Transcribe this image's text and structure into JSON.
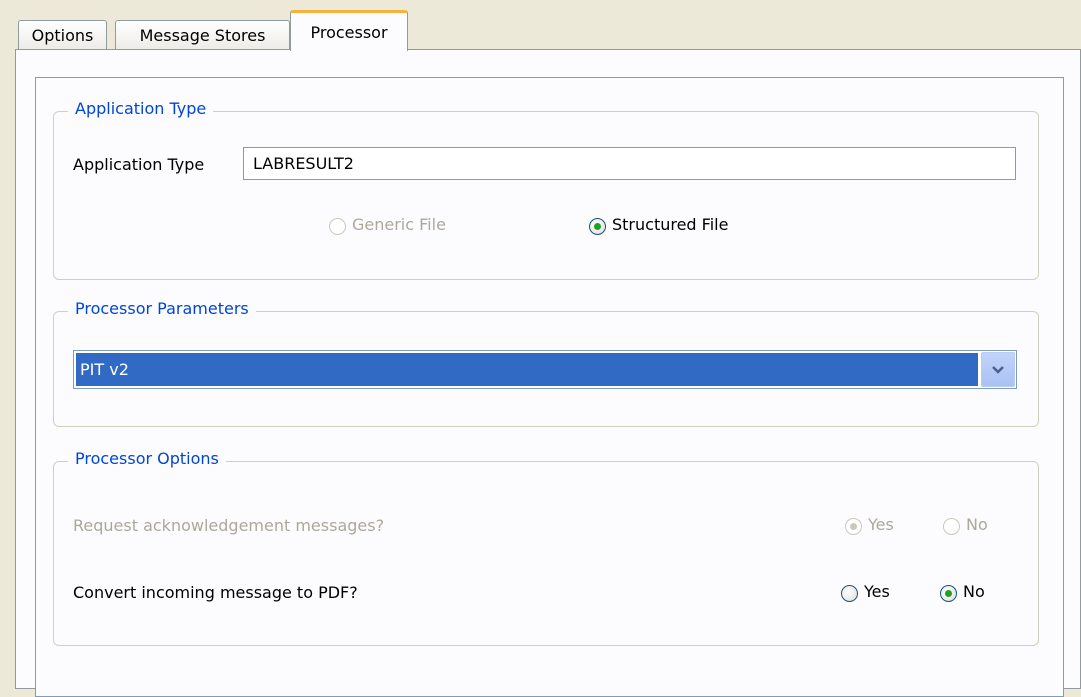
{
  "tabs": [
    {
      "label": "Options",
      "active": false
    },
    {
      "label": "Message Stores",
      "active": false
    },
    {
      "label": "Processor",
      "active": true
    }
  ],
  "application_type_group": {
    "legend": "Application Type",
    "field_label": "Application Type",
    "field_value": "LABRESULT2",
    "generic_file_label": "Generic File",
    "structured_file_label": "Structured File",
    "selected": "Structured File"
  },
  "processor_parameters_group": {
    "legend": "Processor Parameters",
    "selected_value": "PIT v2"
  },
  "processor_options_group": {
    "legend": "Processor Options",
    "ack_question": "Request acknowledgement messages?",
    "ack_yes": "Yes",
    "ack_no": "No",
    "ack_selected": "Yes",
    "ack_enabled": false,
    "pdf_question": "Convert incoming message to PDF?",
    "pdf_yes": "Yes",
    "pdf_no": "No",
    "pdf_selected": "No"
  },
  "colors": {
    "legend_text": "#0046d5",
    "selection_bg": "#316ac5",
    "active_tab_accent": "#f7b13c",
    "radio_checked": "#21a121"
  },
  "icons": {
    "dropdown": "chevron-down-icon"
  }
}
